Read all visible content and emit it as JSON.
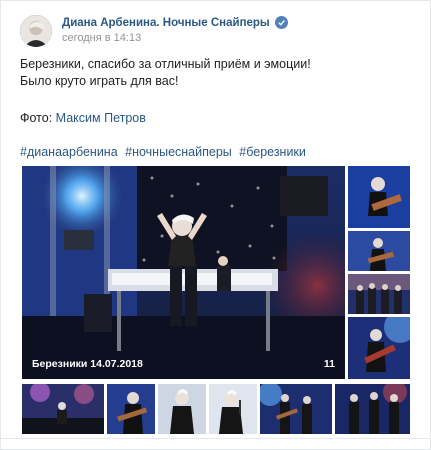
{
  "post": {
    "author": "Диана Арбенина. Ночные Снайперы",
    "timestamp": "сегодня в 14:13",
    "text_line1": "Березники, спасибо за отличный приём и эмоции!",
    "text_line2": "Было круто играть для вас!",
    "photo_prefix": "Фото: ",
    "photo_author": "Максим Петров",
    "hashtags": [
      "#дианаарбенина",
      "#ночныеснайперы",
      "#березники"
    ]
  },
  "gallery": {
    "main_caption": "Березники 14.07.2018",
    "photo_count": "11"
  },
  "icons": {
    "verified": "verified-check-icon"
  },
  "colors": {
    "link": "#2a5885",
    "verified_badge": "#5181b8",
    "timestamp": "#939393"
  }
}
